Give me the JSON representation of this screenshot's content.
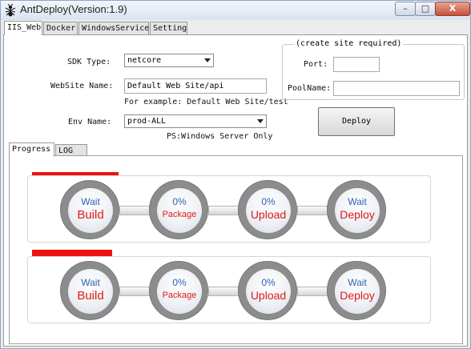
{
  "window": {
    "title": "AntDeploy(Version:1.9)",
    "min_label": "–",
    "max_label": "□",
    "close_label": "X"
  },
  "tabs": [
    {
      "label": "IIS_Web",
      "active": true
    },
    {
      "label": "Docker",
      "active": false
    },
    {
      "label": "WindowsService",
      "active": false
    },
    {
      "label": "Setting",
      "active": false
    }
  ],
  "form": {
    "sdk_label": "SDK Type:",
    "sdk_value": "netcore",
    "website_label": "WebSite Name:",
    "website_value": "Default Web Site/api",
    "website_example": "For example: Default Web Site/test",
    "env_label": "Env Name:",
    "env_value": "prod-ALL",
    "env_note": "PS:Windows Server Only",
    "group_title": "(create site required)",
    "port_label": "Port:",
    "port_value": "",
    "pool_label": "PoolName:",
    "pool_value": "",
    "deploy_label": "Deploy"
  },
  "subtabs": [
    {
      "label": "Progress",
      "active": true
    },
    {
      "label": "LOG",
      "active": false
    }
  ],
  "pipelines": [
    {
      "bar_color": "#ee1111",
      "steps": [
        {
          "top": "Wait",
          "bottom": "Build"
        },
        {
          "top": "0%",
          "bottom": "Package"
        },
        {
          "top": "0%",
          "bottom": "Upload"
        },
        {
          "top": "Wait",
          "bottom": "Deploy"
        }
      ]
    },
    {
      "bar_color": "#ee1111",
      "steps": [
        {
          "top": "Wait",
          "bottom": "Build"
        },
        {
          "top": "0%",
          "bottom": "Package"
        },
        {
          "top": "0%",
          "bottom": "Upload"
        },
        {
          "top": "Wait",
          "bottom": "Deploy"
        }
      ]
    }
  ],
  "colors": {
    "step_top": "#2e5fb3",
    "step_bottom": "#e01a1a",
    "titlebar": "#dfe8f3"
  }
}
